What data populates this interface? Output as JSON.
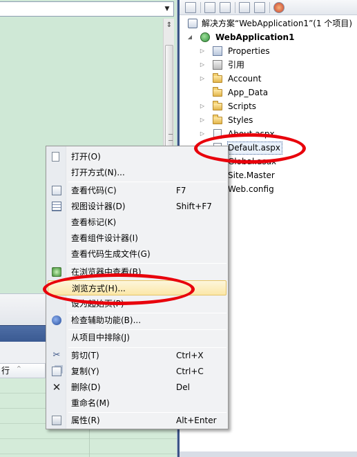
{
  "editor": {
    "bottom_grid_header": "行"
  },
  "solution_explorer": {
    "solution_label": "解决方案“WebApplication1”(1 个项目)",
    "project_label": "WebApplication1",
    "items": [
      {
        "label": "Properties",
        "icon": "properties-icon"
      },
      {
        "label": "引用",
        "icon": "references-icon"
      },
      {
        "label": "Account",
        "icon": "folder-icon"
      },
      {
        "label": "App_Data",
        "icon": "folder-icon"
      },
      {
        "label": "Scripts",
        "icon": "folder-icon"
      },
      {
        "label": "Styles",
        "icon": "folder-icon"
      },
      {
        "label": "About.aspx",
        "icon": "file-icon"
      },
      {
        "label": "Default.aspx",
        "icon": "file-icon",
        "selected": true
      },
      {
        "label": "Global.asax",
        "icon": "file-icon"
      },
      {
        "label": "Site.Master",
        "icon": "file-icon"
      },
      {
        "label": "Web.config",
        "icon": "file-icon"
      }
    ]
  },
  "context_menu": {
    "items": [
      {
        "label": "打开(O)",
        "shortcut": "",
        "icon": "open-icon"
      },
      {
        "label": "打开方式(N)...",
        "shortcut": "",
        "icon": ""
      },
      {
        "label": "查看代码(C)",
        "shortcut": "F7",
        "icon": "code-icon"
      },
      {
        "label": "视图设计器(D)",
        "shortcut": "Shift+F7",
        "icon": "designer-icon"
      },
      {
        "label": "查看标记(K)",
        "shortcut": "",
        "icon": ""
      },
      {
        "label": "查看组件设计器(I)",
        "shortcut": "",
        "icon": ""
      },
      {
        "label": "查看代码生成文件(G)",
        "shortcut": "",
        "icon": ""
      },
      {
        "label": "在浏览器中查看(B)",
        "shortcut": "",
        "icon": "browser-icon"
      },
      {
        "label": "浏览方式(H)...",
        "shortcut": "",
        "icon": "",
        "highlighted": true
      },
      {
        "label": "设为起始页(P)",
        "shortcut": "",
        "icon": ""
      },
      {
        "label": "检查辅助功能(B)...",
        "shortcut": "",
        "icon": "accessibility-icon"
      },
      {
        "label": "从项目中排除(J)",
        "shortcut": "",
        "icon": ""
      },
      {
        "label": "剪切(T)",
        "shortcut": "Ctrl+X",
        "icon": "cut-icon"
      },
      {
        "label": "复制(Y)",
        "shortcut": "Ctrl+C",
        "icon": "copy-icon"
      },
      {
        "label": "删除(D)",
        "shortcut": "Del",
        "icon": "delete-icon"
      },
      {
        "label": "重命名(M)",
        "shortcut": "",
        "icon": ""
      },
      {
        "label": "属性(R)",
        "shortcut": "Alt+Enter",
        "icon": "properties-icon"
      }
    ]
  },
  "colors": {
    "annotation_red": "#e8000b",
    "menu_highlight": "#fbe7a8",
    "editor_background": "#cfe8d6",
    "panel_border": "#3b5587"
  }
}
